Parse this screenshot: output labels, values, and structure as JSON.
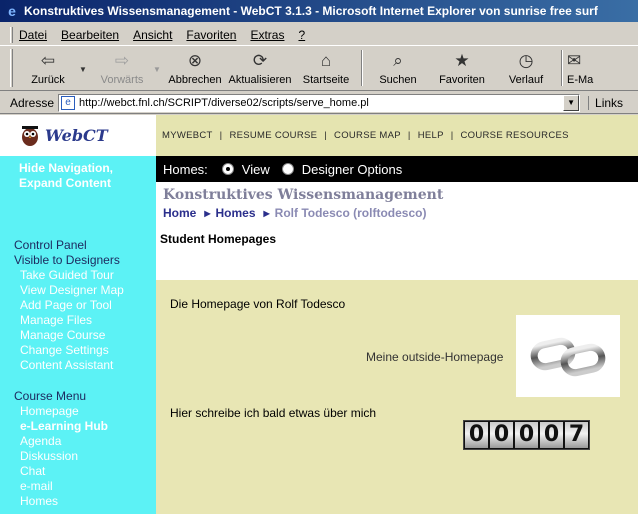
{
  "window": {
    "title": "Konstruktives Wissensmanagement - WebCT 3.1.3 - Microsoft Internet Explorer von sunrise free surf"
  },
  "menubar": {
    "items": [
      {
        "label": "Datei"
      },
      {
        "label": "Bearbeiten"
      },
      {
        "label": "Ansicht"
      },
      {
        "label": "Favoriten"
      },
      {
        "label": "Extras"
      },
      {
        "label": "?"
      }
    ]
  },
  "toolbar": {
    "back": "Zurück",
    "forward": "Vorwärts",
    "stop": "Abbrechen",
    "refresh": "Aktualisieren",
    "home": "Startseite",
    "search": "Suchen",
    "favorites": "Favoriten",
    "history": "Verlauf",
    "mail": "E-Ma"
  },
  "addressbar": {
    "label": "Adresse",
    "url": "http://webct.fnl.ch/SCRIPT/diverse02/scripts/serve_home.pl",
    "links": "Links"
  },
  "logo": {
    "text": "WebCT"
  },
  "topnav": {
    "items": [
      "MYWEBCT",
      "RESUME COURSE",
      "COURSE MAP",
      "HELP",
      "COURSE RESOURCES"
    ]
  },
  "sidebar": {
    "hide_nav_line1": "Hide Navigation,",
    "hide_nav_line2": "Expand Content",
    "control_panel": {
      "head1": "Control Panel",
      "head2": "Visible to Designers",
      "items": [
        "Take Guided Tour",
        "View Designer Map",
        "Add Page or Tool",
        "Manage Files",
        "Manage Course",
        "Change Settings",
        "Content Assistant"
      ]
    },
    "course_menu": {
      "head": "Course Menu",
      "items": [
        "Homepage",
        "e-Learning Hub",
        "Agenda",
        "Diskussion",
        "Chat",
        "e-mail",
        "Homes"
      ]
    }
  },
  "homesbar": {
    "label": "Homes:",
    "view": "View",
    "designer": "Designer Options"
  },
  "content": {
    "course_title": "Konstruktives Wissensmanagement",
    "breadcrumb": [
      "Home",
      "Homes",
      "Rolf Todesco (rolftodesco)"
    ],
    "page_title": "Student Homepages",
    "homepage_title": "Die Homepage von Rolf Todesco",
    "outside_link": "Meine outside-Homepage",
    "message": "Hier schreibe ich bald etwas über mich",
    "counter": "00007"
  },
  "colors": {
    "sidebar_bg": "#5cf2f5",
    "topnav_bg": "#e5e4b0",
    "body_bg": "#e8e6b4",
    "title_bar": "#0a246a"
  }
}
